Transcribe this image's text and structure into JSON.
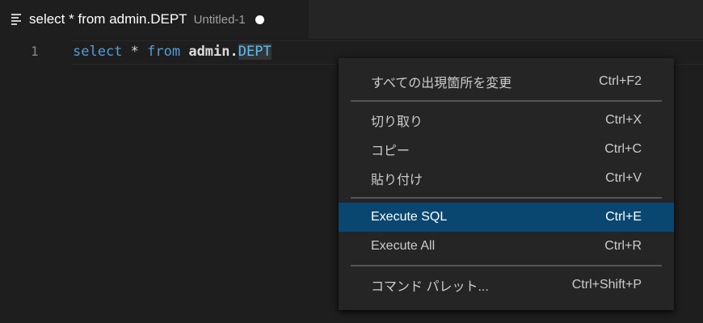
{
  "tab": {
    "title": "select * from admin.DEPT",
    "description": "Untitled-1",
    "icon": "lines-icon",
    "dirty_indicator": "dot-icon"
  },
  "editor": {
    "line_number": "1",
    "tokens": {
      "select": "select",
      "star": " * ",
      "from": "from",
      "admin": " admin.",
      "table": "DEPT"
    }
  },
  "menu": {
    "items": [
      {
        "label": "すべての出現箇所を変更",
        "shortcut": "Ctrl+F2"
      },
      {
        "label": "切り取り",
        "shortcut": "Ctrl+X"
      },
      {
        "label": "コピー",
        "shortcut": "Ctrl+C"
      },
      {
        "label": "貼り付け",
        "shortcut": "Ctrl+V"
      },
      {
        "label": "Execute SQL",
        "shortcut": "Ctrl+E",
        "active": true
      },
      {
        "label": "Execute All",
        "shortcut": "Ctrl+R"
      },
      {
        "label": "コマンド パレット...",
        "shortcut": "Ctrl+Shift+P"
      }
    ]
  },
  "colors": {
    "highlight": "#094771",
    "keyword": "#569cd6"
  }
}
